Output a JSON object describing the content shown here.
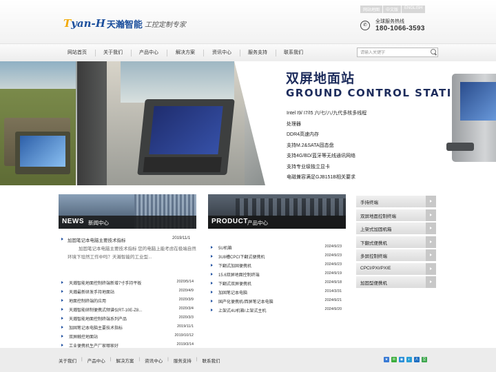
{
  "header": {
    "logo_brand": "yan-H",
    "logo_cn": "天瀚智能",
    "logo_slogan": "工控定制专家",
    "lang_links": [
      "网站地图",
      "中文版",
      "ENGLISH"
    ],
    "hotline_label": "全球服务热线",
    "hotline_number": "180-1066-3593"
  },
  "nav": {
    "items": [
      "网站首页",
      "关于我们",
      "产品中心",
      "解决方案",
      "资讯中心",
      "服务支持",
      "联系我们"
    ],
    "search_placeholder": "请输入关键字"
  },
  "banner": {
    "title_cn": "双屏地面站",
    "title_en": "GROUND CONTROL STATION (GCS)",
    "features": [
      "Intel I9/ I7/I5 六/七/八/九代多核多线程",
      "处理器",
      "DDR4高速内存",
      "支持M.2&SATA固态盘",
      "支持4G/BD/蓝牙等无线通讯网络",
      "支持专业级独立显卡",
      "电磁兼容满足GJB151B相关要求"
    ]
  },
  "news": {
    "title_en": "NEWS",
    "title_cn": "新闻中心",
    "featured": {
      "title": "加固笔记本电脑主要技术指标",
      "date": "2019/11/1",
      "desc": "加固笔记本电脑主要技术指标   您的电脑上能考虑在极端自然环境下坦然工作中吗？天瀚智能的工业型..."
    },
    "items": [
      {
        "title": "天瀚智能地面控制终端新增7寸手持平板",
        "date": "2020/5/14"
      },
      {
        "title": "天瀚最新研发手持地面站",
        "date": "2020/4/9"
      },
      {
        "title": "地面控制终端的应用",
        "date": "2020/3/9"
      },
      {
        "title": "天瀚智能研制便携式频谱仪RT-10E-Z8...",
        "date": "2020/3/4"
      },
      {
        "title": "天瀚智能地面控制终端系列产品",
        "date": "2020/3/3"
      },
      {
        "title": "加固笔记本电脑主要技术指标",
        "date": "2019/11/1"
      },
      {
        "title": "双屏触控地面站",
        "date": "2019/10/12"
      },
      {
        "title": "工业便携机生产厂家哪家好",
        "date": "2019/3/14"
      }
    ]
  },
  "products": {
    "title_en": "PRODUCT",
    "title_cn": "产品中心",
    "items": [
      {
        "title": "5U机箱",
        "date": "2024/9/23"
      },
      {
        "title": "3U8槽CPCI下翻式便携机",
        "date": "2024/9/23"
      },
      {
        "title": "下翻式加固便携机",
        "date": "2024/9/23"
      },
      {
        "title": "15.6双屏地面控制终端",
        "date": "2024/9/19"
      },
      {
        "title": "下翻式双屏便携机",
        "date": "2024/9/18"
      },
      {
        "title": "加固笔记本电脑",
        "date": "2014/3/31"
      },
      {
        "title": "国产化便携机/西屏笔记本电脑",
        "date": "2024/9/21"
      },
      {
        "title": "上架式4U机箱/上架式主机",
        "date": "2024/9/20"
      }
    ]
  },
  "categories": [
    "手持终端",
    "双屏地面控制终端",
    "上架式加固机箱",
    "下翻式便携机",
    "多屏控制终端",
    "CPCI/PXI/PXIE",
    "加固型便携机"
  ],
  "footer": {
    "links": [
      "关于我们",
      "产品中心",
      "解决方案",
      "资讯中心",
      "服务支持",
      "联系我们"
    ],
    "share_icons": [
      "qzone-icon",
      "wechat-icon",
      "weibo-icon",
      "tencent-weibo-icon",
      "renren-icon",
      "douban-icon"
    ]
  },
  "colors": {
    "brand_blue": "#1a4e9c",
    "brand_yellow": "#f2a800",
    "banner_title": "#1d2c5c"
  }
}
